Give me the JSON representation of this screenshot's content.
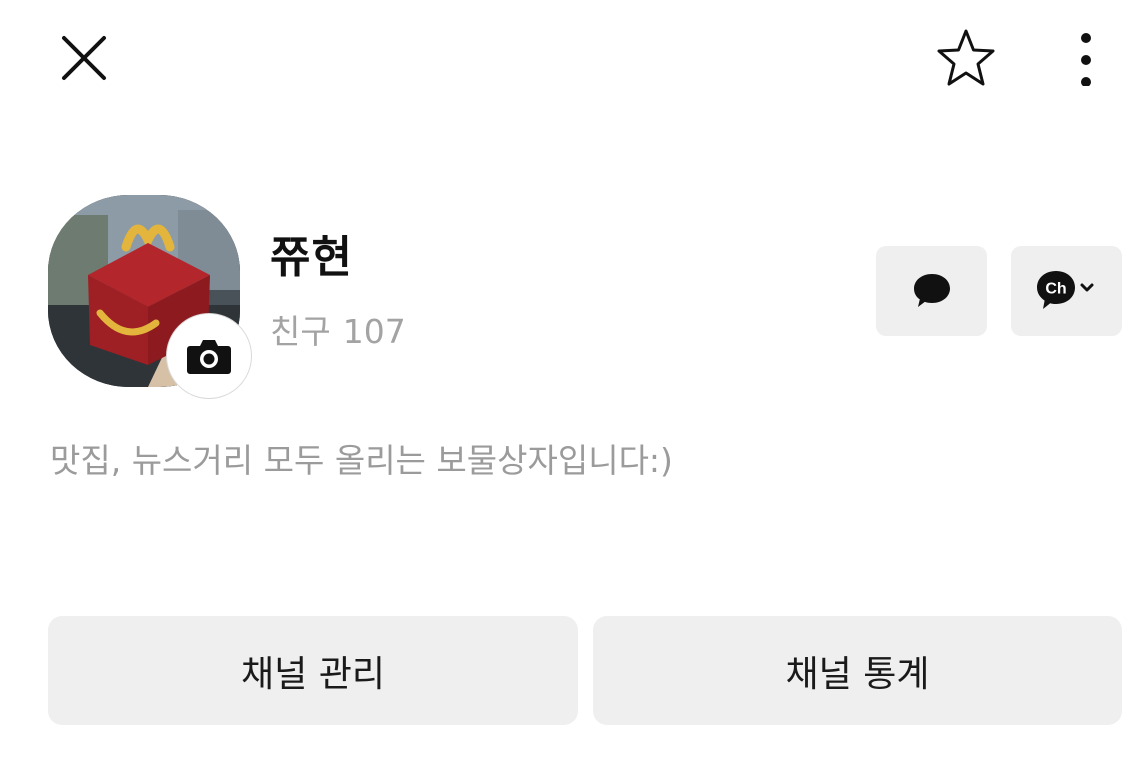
{
  "header": {
    "close_icon": "close-icon",
    "favorite_icon": "star-outline-icon",
    "more_icon": "more-vertical-icon"
  },
  "profile": {
    "name": "쮸현",
    "friends_label": "친구",
    "friends_count": "107",
    "bio": "맛집, 뉴스거리 모두 올리는 보물상자입니다:)",
    "avatar_icon": "photo-avatar",
    "camera_icon": "camera-icon"
  },
  "side_actions": {
    "chat_icon": "chat-bubble-icon",
    "channel_icon": "channel-ch-icon",
    "channel_text": "Ch"
  },
  "actions": {
    "manage_label": "채널 관리",
    "stats_label": "채널 통계"
  },
  "colors": {
    "button_bg": "#efefef",
    "secondary_text": "#9b9b9b",
    "primary_text": "#111111"
  }
}
